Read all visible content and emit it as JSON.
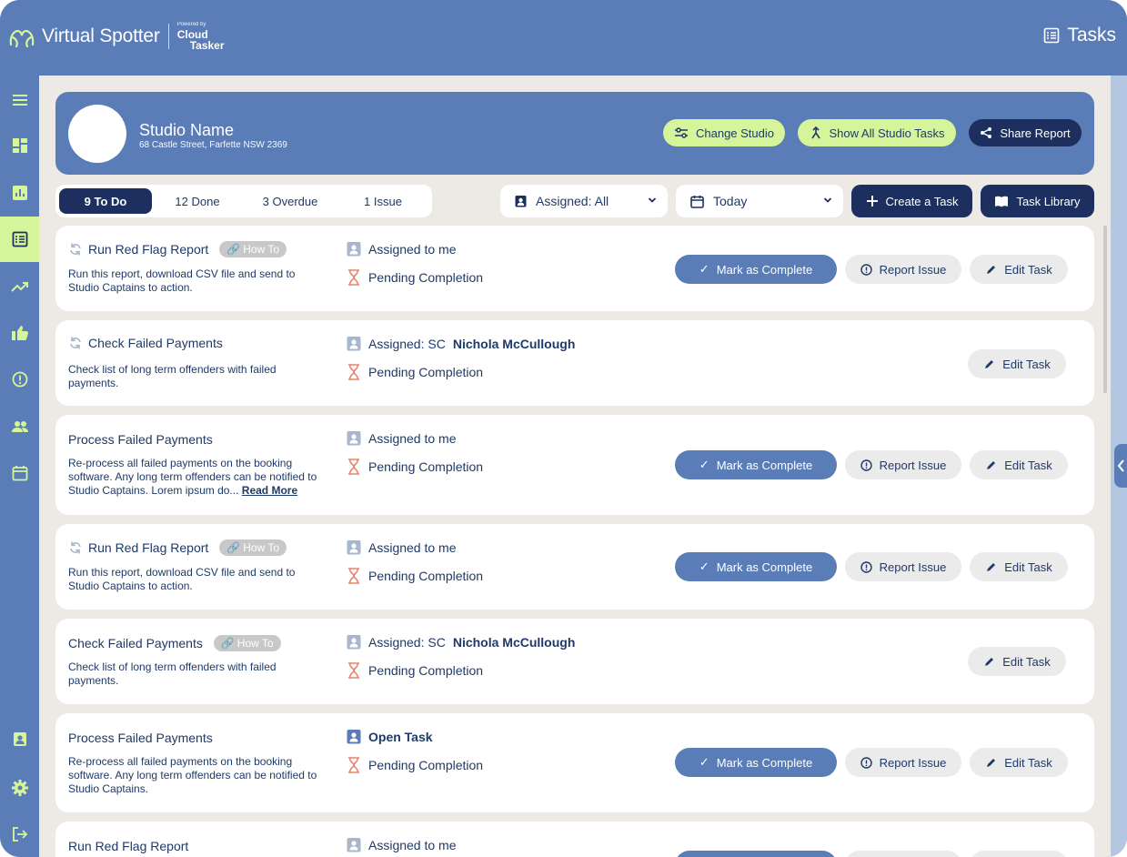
{
  "header": {
    "app_name": "Virtual Spotter",
    "powered_by": "Powered by",
    "partner_line1": "Cloud",
    "partner_line2": "Tasker",
    "page_title": "Tasks"
  },
  "sidebar": {
    "items": [
      {
        "icon": "menu-icon"
      },
      {
        "icon": "dashboard-icon"
      },
      {
        "icon": "bar-chart-icon"
      },
      {
        "icon": "tasks-icon",
        "active": true
      },
      {
        "icon": "trend-icon"
      },
      {
        "icon": "thumbs-up-icon"
      },
      {
        "icon": "alert-icon"
      },
      {
        "icon": "people-icon"
      },
      {
        "icon": "calendar-icon"
      },
      {
        "icon": "badge-icon"
      },
      {
        "icon": "settings-icon"
      },
      {
        "icon": "logout-icon"
      }
    ]
  },
  "studio": {
    "name": "Studio Name",
    "address": "68 Castle Street, Farfette NSW 2369",
    "change_label": "Change Studio",
    "show_all_label": "Show All Studio Tasks",
    "share_label": "Share Report"
  },
  "filters": {
    "tabs": [
      "9 To Do",
      "12 Done",
      "3 Overdue",
      "1 Issue"
    ],
    "assigned_label": "Assigned: All",
    "date_label": "Today",
    "create_label": "Create a Task",
    "library_label": "Task Library"
  },
  "actions": {
    "complete": "Mark as Complete",
    "issue": "Report Issue",
    "edit": "Edit Task",
    "how_to": "How To",
    "read_more": "Read More"
  },
  "tasks": [
    {
      "title": "Run Red Flag Report",
      "desc": "Run this report, download CSV file and send to Studio Captains to action.",
      "assign_prefix": "Assigned to me",
      "assign_name": "",
      "status": "Pending Completion"
    },
    {
      "title": "Check Failed Payments",
      "desc": "Check list of long term offenders with failed payments.",
      "assign_prefix": "Assigned: SC",
      "assign_name": "Nichola McCullough",
      "status": "Pending Completion"
    },
    {
      "title": "Process Failed Payments",
      "desc": "Re-process all failed payments on the booking software. Any long term offenders can be notified to Studio Captains. Lorem ipsum do...",
      "assign_prefix": "Assigned to me",
      "assign_name": "",
      "status": "Pending Completion"
    },
    {
      "title": "Run Red Flag Report",
      "desc": "Run this report, download CSV file and send to Studio Captains to action.",
      "assign_prefix": "Assigned to me",
      "assign_name": "",
      "status": "Pending Completion"
    },
    {
      "title": "Check Failed Payments",
      "desc": "Check list of long term offenders with failed payments.",
      "assign_prefix": "Assigned: SC",
      "assign_name": "Nichola McCullough",
      "status": "Pending Completion"
    },
    {
      "title": "Process Failed Payments",
      "desc": "Re-process all failed payments on the booking software. Any long term offenders can be notified to Studio Captains.",
      "assign_prefix": "",
      "assign_name": "Open Task",
      "status": "Pending Completion"
    },
    {
      "title": "Run Red Flag Report",
      "desc": "",
      "assign_prefix": "Assigned to me",
      "assign_name": "",
      "status": ""
    }
  ],
  "colors": {
    "brand_blue": "#5a7db7",
    "navy": "#1c2f5e",
    "lime": "#d6f59a",
    "hourglass": "#e8826a",
    "background": "#ede9e4"
  }
}
